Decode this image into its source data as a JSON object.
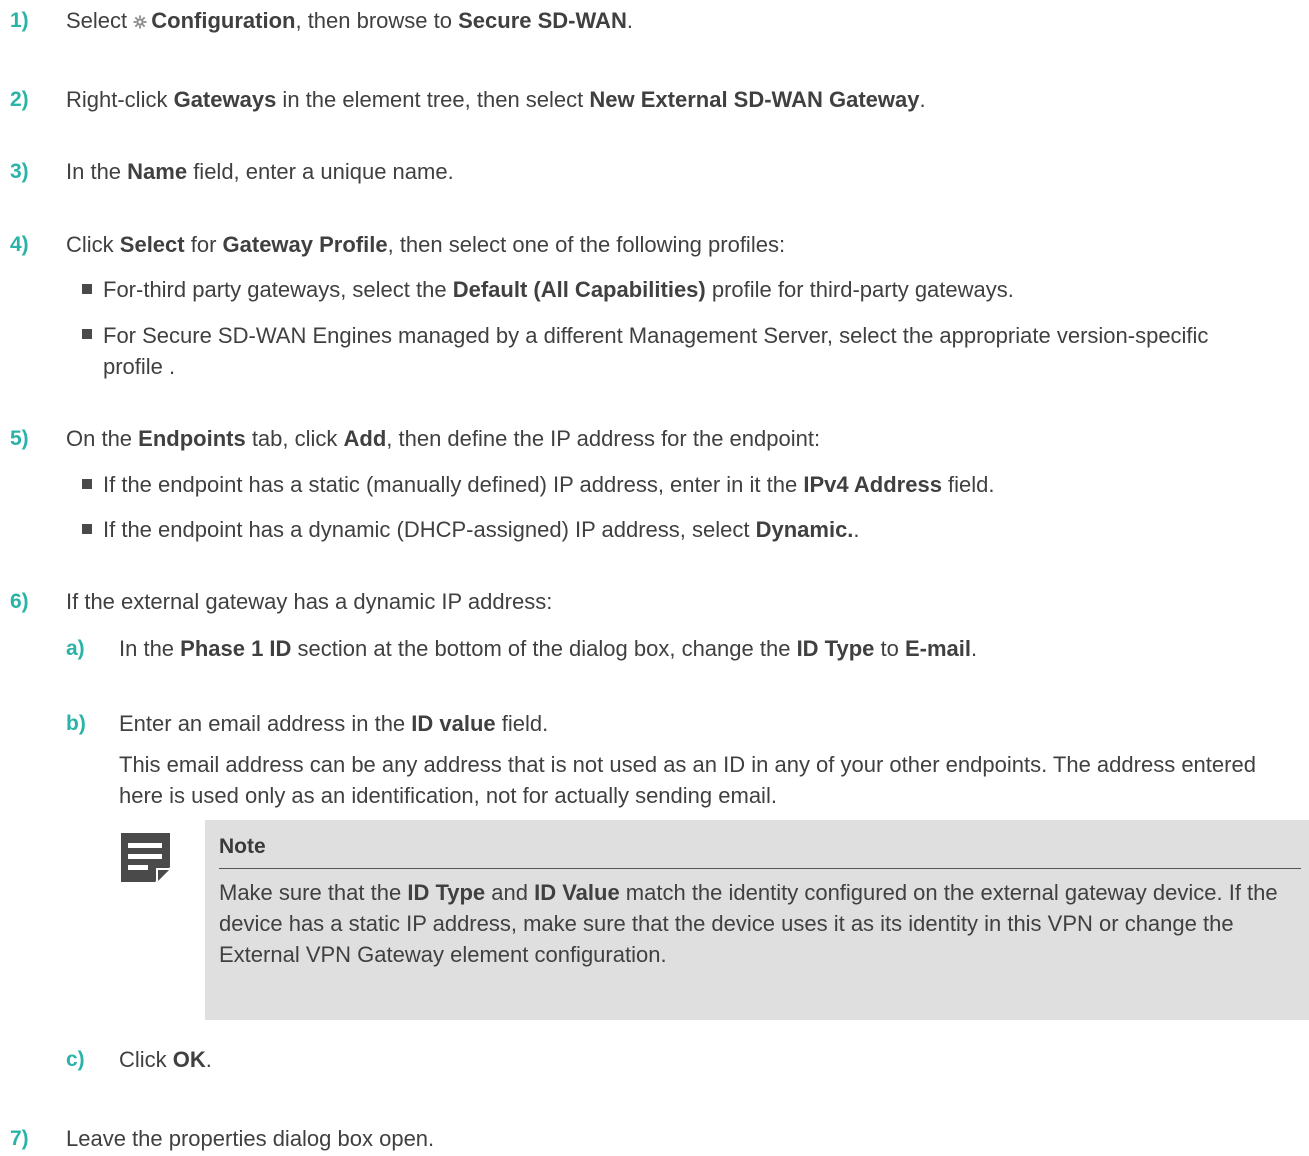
{
  "steps": {
    "s1": {
      "num": "1)",
      "a": "Select ",
      "b": "Configuration",
      "c": ", then browse to ",
      "d": "Secure SD-WAN",
      "e": "."
    },
    "s2": {
      "num": "2)",
      "a": "Right-click ",
      "b": "Gateways",
      "c": " in the element tree, then select ",
      "d": "New External SD-WAN Gateway",
      "e": "."
    },
    "s3": {
      "num": "3)",
      "a": "In the ",
      "b": "Name",
      "c": " field, enter a unique name."
    },
    "s4": {
      "num": "4)",
      "a": "Click ",
      "b": "Select",
      "c": " for ",
      "d": "Gateway Profile",
      "e": ", then select one of the following profiles:",
      "bullet1": {
        "a": "For-third party gateways, select the ",
        "b": "Default (All Capabilities)",
        "c": " profile for third-party gateways."
      },
      "bullet2": {
        "a": "For Secure SD-WAN Engines managed by a different Management Server, select the appropriate version-specific profile ."
      }
    },
    "s5": {
      "num": "5)",
      "a": "On the ",
      "b": "Endpoints",
      "c": " tab, click ",
      "d": "Add",
      "e": ", then define the IP address for the endpoint:",
      "bullet1": {
        "a": "If the endpoint has a static (manually defined) IP address, enter in it the ",
        "b": "IPv4 Address",
        "c": " field."
      },
      "bullet2": {
        "a": "If the endpoint has a dynamic (DHCP-assigned) IP address, select ",
        "b": "Dynamic.",
        "c": "."
      }
    },
    "s6": {
      "num": "6)",
      "a": "If the external gateway has a dynamic IP address:",
      "sa": {
        "letter": "a)",
        "a": "In the ",
        "b": "Phase 1 ID",
        "c": " section at the bottom of the dialog box, change the ",
        "d": "ID Type",
        "e": " to ",
        "f": "E-mail",
        "g": "."
      },
      "sb": {
        "letter": "b)",
        "a": "Enter an email address in the ",
        "b": "ID value",
        "c": " field.",
        "para": "This email address can be any address that is not used as an ID in any of your other endpoints. The address entered here is used only as an identification, not for actually sending email."
      },
      "note": {
        "title": "Note",
        "a": "Make sure that the ",
        "b": "ID Type",
        "c": " and ",
        "d": "ID Value",
        "e": " match the identity configured on the external gateway device. If the device has a static IP address, make sure that the device uses it as its identity in this VPN or change the External VPN Gateway element configuration."
      },
      "sc": {
        "letter": "c)",
        "a": "Click ",
        "b": "OK",
        "c": "."
      }
    },
    "s7": {
      "num": "7)",
      "a": "Leave the properties dialog box open."
    }
  },
  "colors": {
    "accent": "#2ab3a6",
    "text": "#404040",
    "note_bg": "#dfdfdf",
    "icon": "#4a4a4a"
  },
  "icons": [
    "gear-icon",
    "note-icon",
    "bullet-square-icon"
  ]
}
